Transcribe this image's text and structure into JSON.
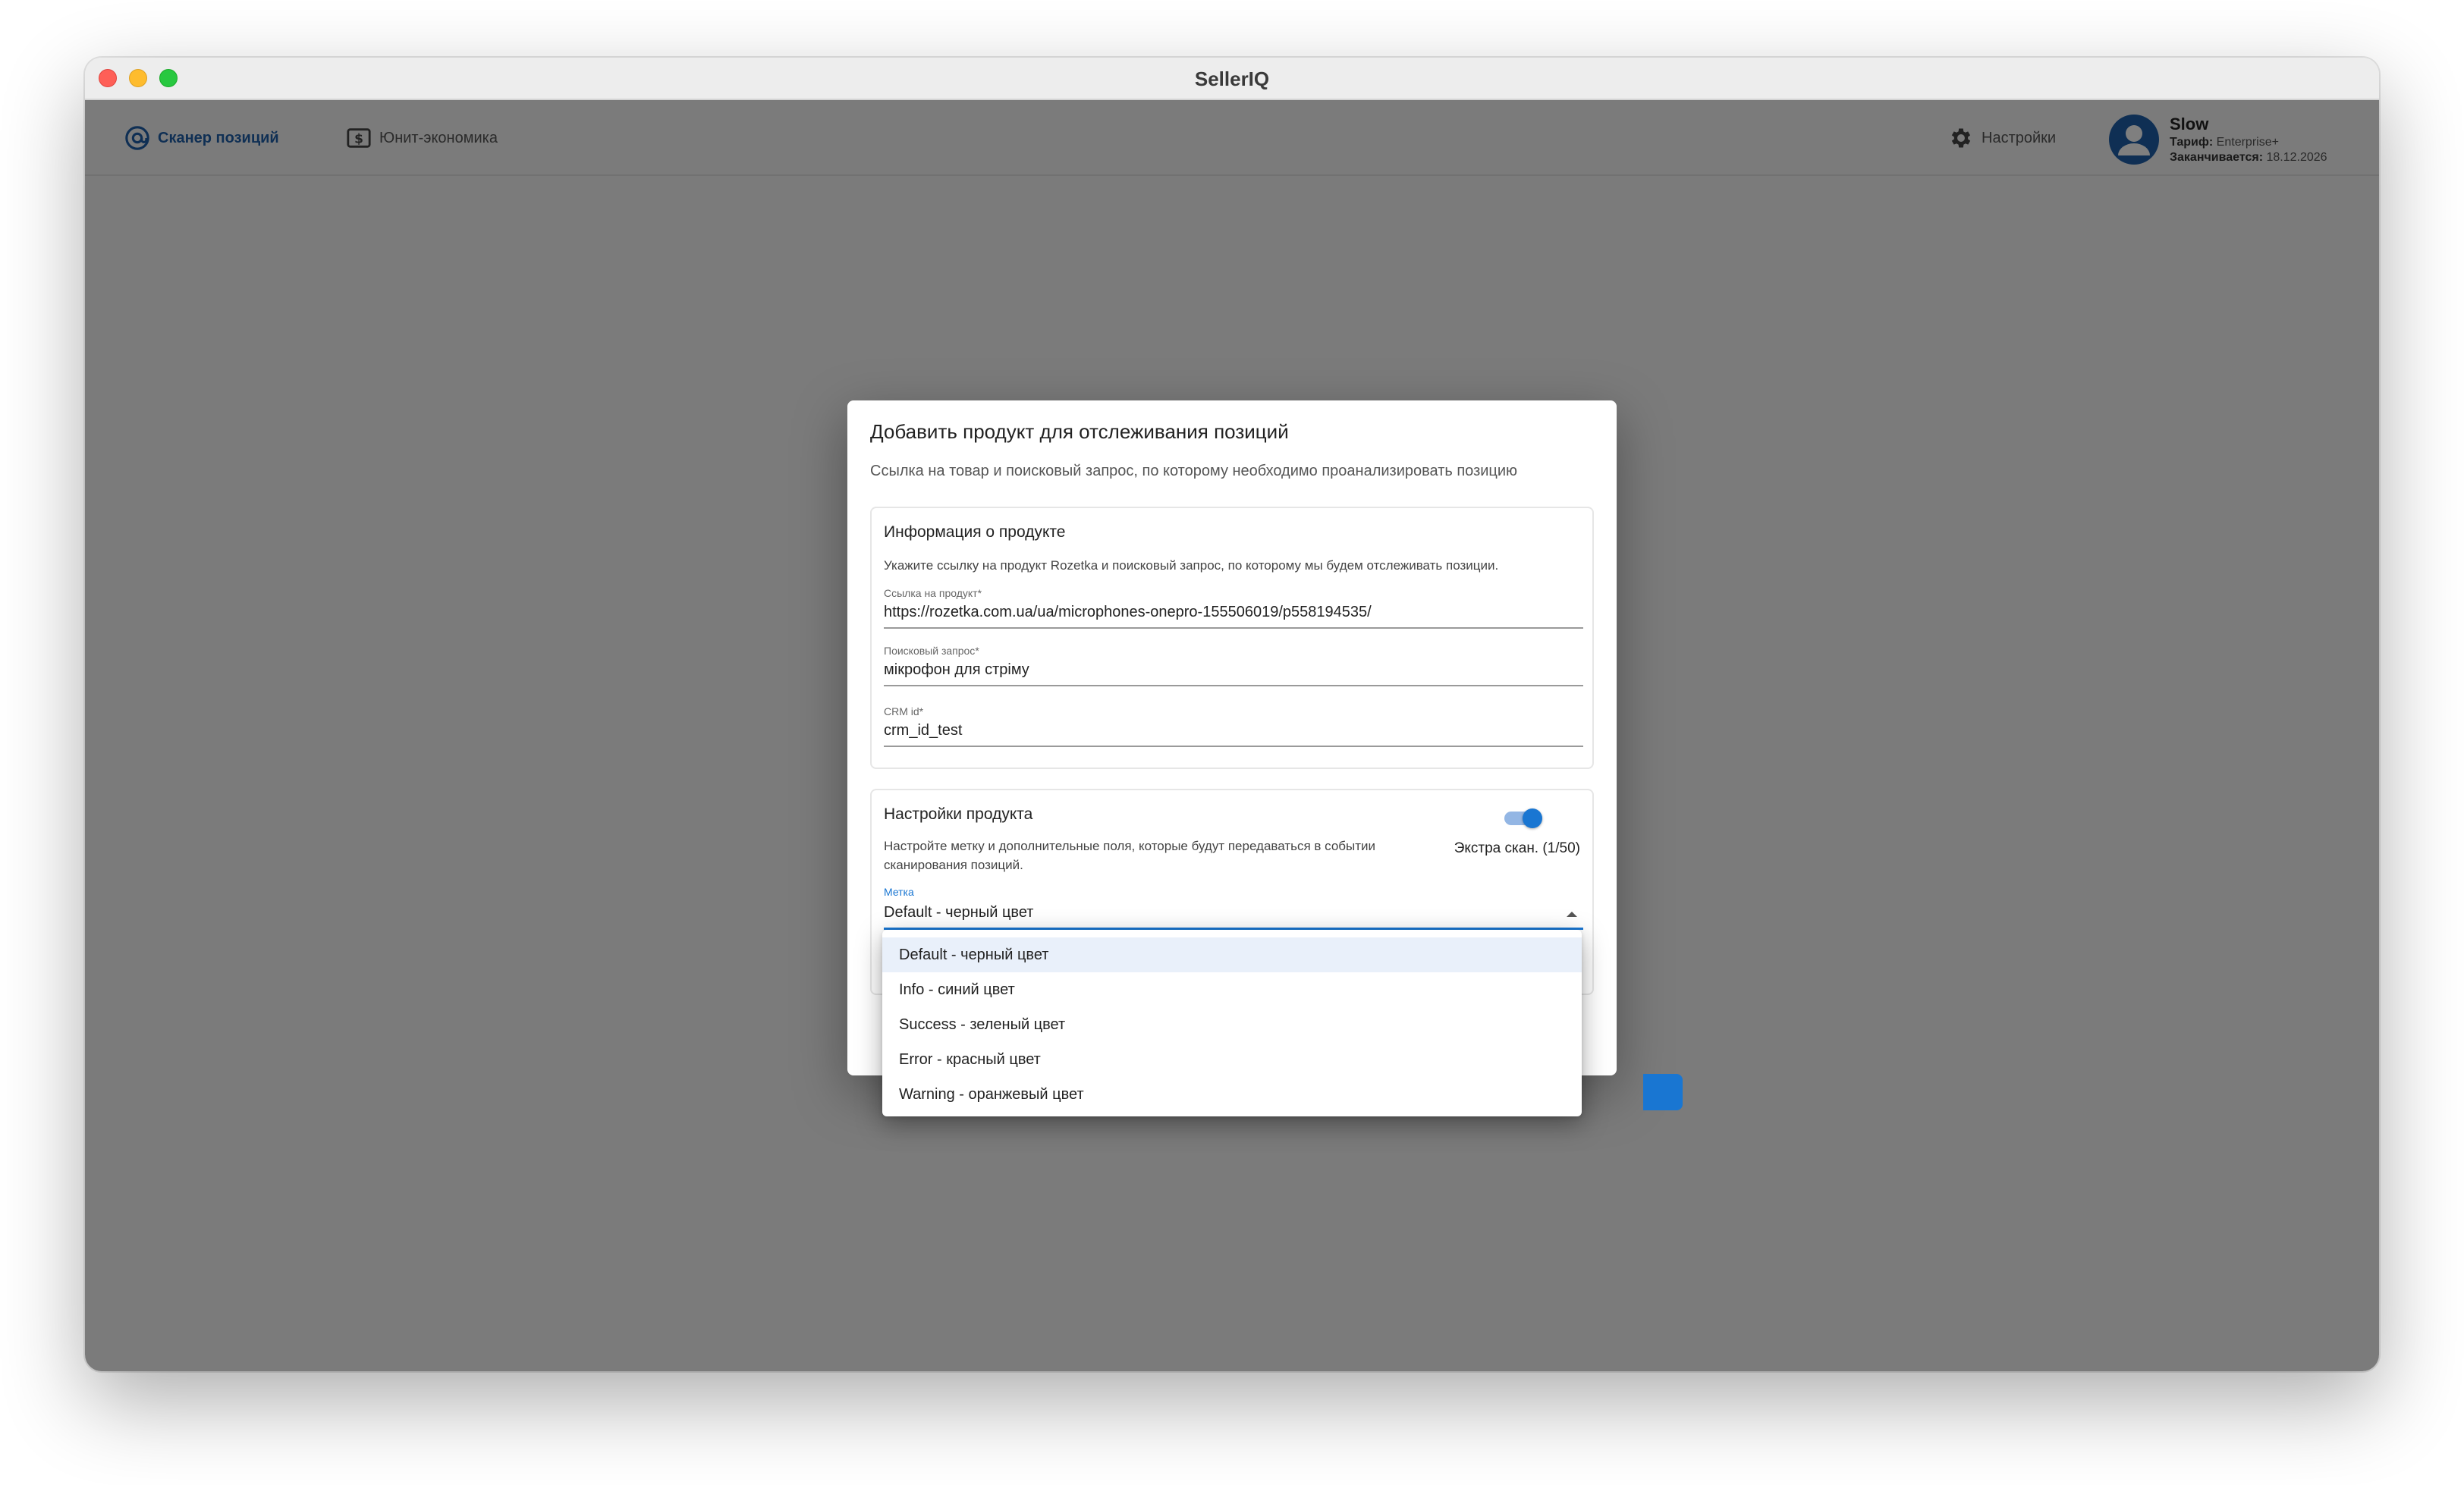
{
  "window": {
    "title": "SellerIQ"
  },
  "nav": {
    "scanner_label": "Сканер позиций",
    "unit_label": "Юнит-экономика",
    "settings_label": "Настройки"
  },
  "user": {
    "name": "Slow",
    "tariff_key": "Тариф:",
    "tariff_value": "Enterprise+",
    "expires_key": "Заканчивается:",
    "expires_value": "18.12.2026"
  },
  "dialog": {
    "title": "Добавить продукт для отслеживания позиций",
    "subtitle": "Ссылка на товар и поисковый запрос, по которому необходимо проанализировать позицию",
    "info_card": {
      "title": "Информация о продукте",
      "description": "Укажите ссылку на продукт Rozetka и поисковый запрос, по которому мы будем отслеживать позиции.",
      "fields": [
        {
          "label": "Ссылка на продукт",
          "required_mark": "*",
          "value": "https://rozetka.com.ua/ua/microphones-onepro-155506019/p558194535/"
        },
        {
          "label": "Поисковый запрос",
          "required_mark": "*",
          "value": "мікрофон для стріму"
        },
        {
          "label": "CRM id",
          "required_mark": "*",
          "value": "crm_id_test"
        }
      ]
    },
    "settings_card": {
      "title": "Настройки продукта",
      "description": "Настройте метку и дополнительные поля, которые будут передаваться в событии сканирования позиций.",
      "toggle_label": "Экстра скан. (1/50)",
      "toggle_on": true,
      "select_label": "Метка",
      "select_value": "Default - черный цвет"
    }
  },
  "menu": {
    "options": [
      "Default - черный цвет",
      "Info - синий цвет",
      "Success - зеленый цвет",
      "Error - красный цвет",
      "Warning - оранжевый цвет"
    ],
    "selected_index": 0
  },
  "colors": {
    "accent": "#1976d2",
    "nav_active": "#1f5fa8",
    "backdrop": "rgba(0,0,0,0.5)"
  },
  "icons": {
    "scanner": "at-sign-icon",
    "unit": "dollar-box-icon",
    "settings": "gear-icon",
    "avatar": "account-circle-icon",
    "select_caret": "caret-up-icon"
  }
}
